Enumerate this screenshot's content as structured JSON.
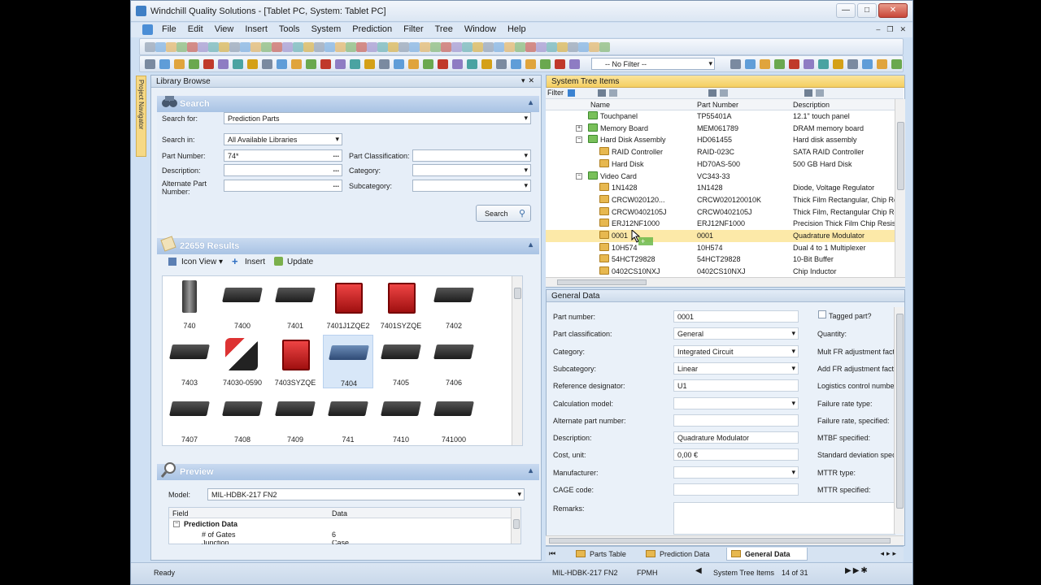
{
  "window": {
    "title": "Windchill Quality Solutions - [Tablet PC, System: Tablet PC]"
  },
  "menu": [
    "File",
    "Edit",
    "View",
    "Insert",
    "Tools",
    "System",
    "Prediction",
    "Filter",
    "Tree",
    "Window",
    "Help"
  ],
  "toolbar": {
    "filter_value": "-- No Filter --"
  },
  "side_tab": "Project Navigator",
  "library": {
    "title": "Library Browse",
    "search_header": "Search",
    "search_for_label": "Search for:",
    "search_for_value": "Prediction Parts",
    "search_in_label": "Search in:",
    "search_in_value": "All Available Libraries",
    "part_number_label": "Part Number:",
    "part_number_value": "74*",
    "part_class_label": "Part Classification:",
    "description_label": "Description:",
    "category_label": "Category:",
    "alt_part_label": "Alternate Part Number:",
    "subcategory_label": "Subcategory:",
    "search_button": "Search",
    "results_header": "22659 Results",
    "icon_view": "Icon View",
    "insert": "Insert",
    "update": "Update",
    "items": [
      {
        "label": "740",
        "kind": "transistor"
      },
      {
        "label": "7400",
        "kind": "chip"
      },
      {
        "label": "7401",
        "kind": "chip"
      },
      {
        "label": "7401J1ZQE2",
        "kind": "red"
      },
      {
        "label": "7401SYZQE",
        "kind": "red"
      },
      {
        "label": "7402",
        "kind": "chip"
      },
      {
        "label": "7403",
        "kind": "chip"
      },
      {
        "label": "74030-0590",
        "kind": "cable"
      },
      {
        "label": "7403SYZQE",
        "kind": "red"
      },
      {
        "label": "7404",
        "kind": "bluechip"
      },
      {
        "label": "7405",
        "kind": "chip"
      },
      {
        "label": "7406",
        "kind": "chip"
      },
      {
        "label": "7407",
        "kind": "chip"
      },
      {
        "label": "7408",
        "kind": "chip"
      },
      {
        "label": "7409",
        "kind": "chip"
      },
      {
        "label": "741",
        "kind": "chip"
      },
      {
        "label": "7410",
        "kind": "chip"
      },
      {
        "label": "741000",
        "kind": "chip"
      }
    ],
    "preview_header": "Preview",
    "model_label": "Model:",
    "model_value": "MIL-HDBK-217 FN2",
    "preview_cols": [
      "Field",
      "Data"
    ],
    "preview_group": "Prediction Data",
    "preview_rows": [
      {
        "field": "# of Gates",
        "data": "6"
      },
      {
        "field": "Junction",
        "data": "Case"
      }
    ]
  },
  "tree": {
    "title": "System Tree Items",
    "filter_label": "Filter",
    "columns": [
      "Name",
      "Part Number",
      "Description"
    ],
    "rows": [
      {
        "name": "Touchpanel",
        "pn": "TP55401A",
        "desc": "12.1\" touch panel",
        "indent": 1,
        "icon": "green",
        "exp": ""
      },
      {
        "name": "Memory Board",
        "pn": "MEM061789",
        "desc": "DRAM memory board",
        "indent": 1,
        "icon": "green",
        "exp": "+"
      },
      {
        "name": "Hard Disk Assembly",
        "pn": "HD061455",
        "desc": "Hard disk assembly",
        "indent": 1,
        "icon": "green",
        "exp": "−"
      },
      {
        "name": "RAID Controller",
        "pn": "RAID-023C",
        "desc": "SATA RAID Controller",
        "indent": 2,
        "icon": "yellow",
        "exp": ""
      },
      {
        "name": "Hard Disk",
        "pn": "HD70AS-500",
        "desc": "500 GB Hard Disk",
        "indent": 2,
        "icon": "yellow",
        "exp": ""
      },
      {
        "name": "Video Card",
        "pn": "VC343-33",
        "desc": "",
        "indent": 1,
        "icon": "green",
        "exp": "−"
      },
      {
        "name": "1N1428",
        "pn": "1N1428",
        "desc": "Diode, Voltage Regulator",
        "indent": 2,
        "icon": "yellow",
        "exp": ""
      },
      {
        "name": "CRCW020120...",
        "pn": "CRCW020120010K",
        "desc": "Thick Film Rectangular, Chip Res",
        "indent": 2,
        "icon": "yellow",
        "exp": ""
      },
      {
        "name": "CRCW0402105J",
        "pn": "CRCW0402105J",
        "desc": "Thick Film, Rectangular Chip Res",
        "indent": 2,
        "icon": "yellow",
        "exp": ""
      },
      {
        "name": "ERJ12NF1000",
        "pn": "ERJ12NF1000",
        "desc": "Precision Thick Film Chip Resisto",
        "indent": 2,
        "icon": "yellow",
        "exp": ""
      },
      {
        "name": "0001",
        "pn": "0001",
        "desc": "Quadrature Modulator",
        "indent": 2,
        "icon": "yellow",
        "exp": "",
        "selected": true
      },
      {
        "name": "10H574",
        "pn": "10H574",
        "desc": "Dual 4 to 1 Multiplexer",
        "indent": 2,
        "icon": "yellow",
        "exp": ""
      },
      {
        "name": "54HCT29828",
        "pn": "54HCT29828",
        "desc": "10-Bit Buffer",
        "indent": 2,
        "icon": "yellow",
        "exp": ""
      },
      {
        "name": "0402CS10NXJ",
        "pn": "0402CS10NXJ",
        "desc": "Chip Inductor",
        "indent": 2,
        "icon": "yellow",
        "exp": ""
      }
    ]
  },
  "general": {
    "title": "General Data",
    "fields": [
      {
        "label": "Part number:",
        "value": "0001",
        "dd": false
      },
      {
        "label": "Part classification:",
        "value": "General",
        "dd": true
      },
      {
        "label": "Category:",
        "value": "Integrated Circuit",
        "dd": true
      },
      {
        "label": "Subcategory:",
        "value": "Linear",
        "dd": true
      },
      {
        "label": "Reference designator:",
        "value": "U1",
        "dd": false
      },
      {
        "label": "Calculation model:",
        "value": "",
        "dd": true
      },
      {
        "label": "Alternate part number:",
        "value": "",
        "dd": false
      },
      {
        "label": "Description:",
        "value": "Quadrature Modulator",
        "dd": false
      },
      {
        "label": "Cost, unit:",
        "value": "0,00 €",
        "dd": false
      },
      {
        "label": "Manufacturer:",
        "value": "",
        "dd": true
      },
      {
        "label": "CAGE code:",
        "value": "",
        "dd": false
      }
    ],
    "remarks_label": "Remarks:",
    "right_labels": [
      "Tagged part?",
      "Quantity:",
      "Mult FR adjustment facto",
      "Add FR adjustment facto",
      "Logistics control number",
      "Failure rate type:",
      "Failure rate, specified:",
      "MTBF specified:",
      "Standard deviation spec",
      "MTTR type:",
      "MTTR specified:"
    ]
  },
  "tabs": [
    "Parts Table",
    "Prediction Data",
    "General Data"
  ],
  "status": {
    "left": "Ready",
    "model": "MIL-HDBK-217 FN2",
    "unit": "FPMH",
    "nav_label": "System Tree Items",
    "nav_pos": "14 of 31"
  }
}
